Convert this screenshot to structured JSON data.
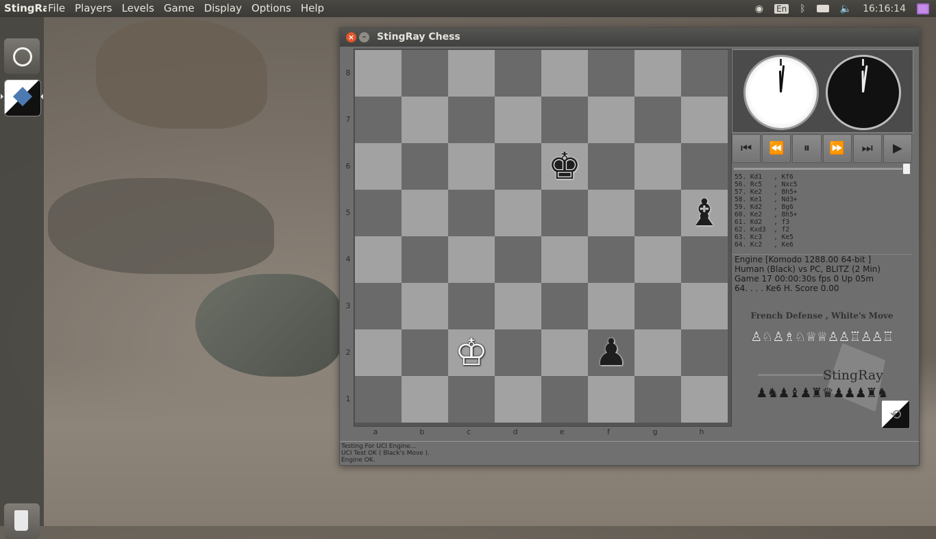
{
  "panel": {
    "app_name": "StingRay",
    "menus": [
      "File",
      "Players",
      "Levels",
      "Game",
      "Display",
      "Options",
      "Help"
    ],
    "keyboard_label": "En",
    "clock": "16:16:14"
  },
  "window": {
    "title": "StingRay Chess",
    "close_glyph": "×",
    "min_glyph": "–"
  },
  "board": {
    "ranks": [
      "8",
      "7",
      "6",
      "5",
      "4",
      "3",
      "2",
      "1"
    ],
    "files": [
      "a",
      "b",
      "c",
      "d",
      "e",
      "f",
      "g",
      "h"
    ],
    "pieces": [
      {
        "square": "e6",
        "glyph": "♚",
        "color": "black",
        "name": "black-king"
      },
      {
        "square": "h5",
        "glyph": "♝",
        "color": "black",
        "name": "black-bishop"
      },
      {
        "square": "c2",
        "glyph": "♔",
        "color": "white",
        "name": "white-king"
      },
      {
        "square": "f2",
        "glyph": "♟",
        "color": "black",
        "name": "black-pawn"
      }
    ]
  },
  "transport": {
    "buttons": [
      {
        "name": "first-move-button",
        "glyph": "⏮"
      },
      {
        "name": "rewind-button",
        "glyph": "⏪"
      },
      {
        "name": "pause-button",
        "glyph": "⏸"
      },
      {
        "name": "forward-button",
        "glyph": "⏩"
      },
      {
        "name": "last-move-button",
        "glyph": "⏭"
      },
      {
        "name": "play-button",
        "glyph": "▶"
      }
    ]
  },
  "moves": [
    "55. Kd1   , Kf6",
    "56. Rc5   , Nxc5",
    "57. Ke2   , Bh5+",
    "58. Ke1   , Nd3+",
    "59. Kd2   , Bg6",
    "60. Ke2   , Bh5+",
    "61. Kd2   , f3",
    "62. Kxd3  , f2",
    "63. Kc3   , Ke5",
    "64. Kc2   , Ke6"
  ],
  "info": {
    "engine": "Engine [Komodo 1288.00 64-bit ]",
    "players": "Human (Black) vs PC, BLITZ (2 Min)",
    "game": "Game 17 00:00:30s fps 0 Up 05m",
    "last_move": "64.     . . .  Ke6  H. Score 0.00"
  },
  "opening": "French Defense , White's Move",
  "captured_white": "♙♘♙♗♘♕♕♙♙♖♙♙♖",
  "captured_black": "♟♞♟♝♟♜♛♟♟♟♜♞",
  "logo_text": "StingRay",
  "status_lines": [
    "Testing For UCI Engine...",
    "UCI Test OK ( Black's Move ).",
    "Engine OK."
  ]
}
